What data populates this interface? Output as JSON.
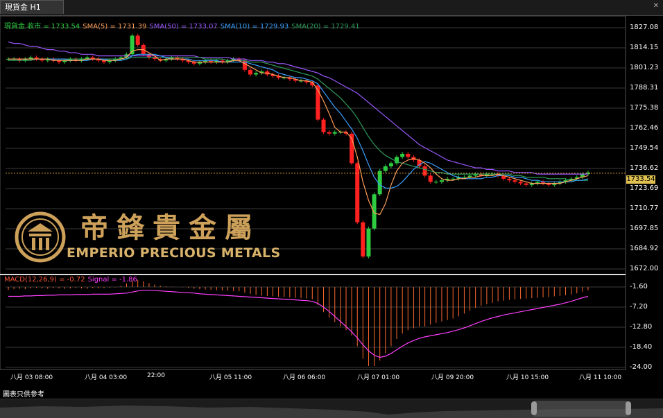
{
  "tab": {
    "title": "現貨金 H1"
  },
  "window_controls": {
    "close": "✕"
  },
  "legend_main": {
    "close": {
      "label": "現貨金.收市 = 1733.54",
      "color": "#2ecc40"
    },
    "sma5": {
      "label": "SMA(5) = 1731.39",
      "color": "#ff9f5a"
    },
    "sma50": {
      "label": "SMA(50) = 1733.07",
      "color": "#9b59ff"
    },
    "sma10": {
      "label": "SMA(10) = 1729.93",
      "color": "#3aa0ff"
    },
    "sma20": {
      "label": "SMA(20) = 1729.41",
      "color": "#2e9c5a"
    }
  },
  "legend_macd": {
    "macd": {
      "label": "MACD(12,26,9) = -0.72",
      "color": "#ff5a3a"
    },
    "signal": {
      "label": "Signal = -1.86",
      "color": "#ff40ff"
    }
  },
  "logo": {
    "chinese": "帝鋒貴金屬",
    "english": "EMPERIO PRECIOUS METALS"
  },
  "current_price": "1733.54",
  "disclaimer": "圖表只供參考",
  "chart_data": {
    "type": "candlestick",
    "price_axis": {
      "ticks": [
        "1827.08",
        "1814.15",
        "1801.23",
        "1788.31",
        "1775.38",
        "1762.46",
        "1749.54",
        "1736.62",
        "1723.69",
        "1710.77",
        "1697.85",
        "1684.92",
        "1672.00"
      ],
      "range": [
        1672.0,
        1827.08
      ]
    },
    "macd_axis": {
      "ticks": [
        "-1.60",
        "-7.20",
        "-12.80",
        "-18.40",
        "-24.00"
      ],
      "range": [
        -24.0,
        -1.6
      ]
    },
    "x_ticks": [
      "八月 03 08:00",
      "八月 04 03:00",
      "22:00",
      "八月 05 11:00",
      "八月 06 06:00",
      "八月 07 01:00",
      "八月 09 20:00",
      "八月 10 15:00",
      "八月 11 10:00"
    ],
    "close_series": [
      1807,
      1807,
      1806,
      1807,
      1808,
      1807,
      1806,
      1807,
      1806,
      1805,
      1806,
      1807,
      1806,
      1807,
      1808,
      1807,
      1806,
      1805,
      1806,
      1807,
      1808,
      1810,
      1822,
      1816,
      1810,
      1808,
      1807,
      1806,
      1807,
      1808,
      1807,
      1806,
      1805,
      1804,
      1805,
      1806,
      1805,
      1806,
      1805,
      1806,
      1807,
      1806,
      1800,
      1797,
      1798,
      1799,
      1797,
      1796,
      1795,
      1795,
      1794,
      1793,
      1793,
      1792,
      1790,
      1768,
      1760,
      1759,
      1760,
      1760,
      1759,
      1740,
      1702,
      1680,
      1698,
      1720,
      1735,
      1738,
      1740,
      1744,
      1746,
      1744,
      1742,
      1738,
      1732,
      1728,
      1728,
      1729,
      1730,
      1730,
      1731,
      1731,
      1732,
      1733,
      1732,
      1733,
      1733,
      1732,
      1730,
      1729,
      1728,
      1727,
      1726,
      1727,
      1728,
      1727,
      1726,
      1727,
      1728,
      1729,
      1730,
      1731,
      1733,
      1734
    ],
    "sma5": [
      1807,
      1807,
      1807,
      1807,
      1807,
      1807,
      1807,
      1807,
      1806,
      1806,
      1806,
      1806,
      1806,
      1806,
      1807,
      1807,
      1807,
      1806,
      1806,
      1806,
      1807,
      1808,
      1812,
      1813,
      1813,
      1811,
      1809,
      1806,
      1807,
      1807,
      1807,
      1807,
      1806,
      1805,
      1805,
      1805,
      1805,
      1805,
      1805,
      1805,
      1806,
      1806,
      1804,
      1802,
      1800,
      1798,
      1798,
      1797,
      1796,
      1795,
      1795,
      1794,
      1793,
      1793,
      1792,
      1787,
      1780,
      1772,
      1763,
      1760,
      1760,
      1756,
      1744,
      1728,
      1716,
      1708,
      1707,
      1714,
      1726,
      1735,
      1740,
      1742,
      1743,
      1742,
      1740,
      1737,
      1733,
      1730,
      1729,
      1729,
      1730,
      1730,
      1731,
      1731,
      1732,
      1732,
      1732,
      1733,
      1732,
      1731,
      1730,
      1729,
      1728,
      1727,
      1727,
      1727,
      1727,
      1727,
      1727,
      1728,
      1729,
      1730,
      1731,
      1732
    ],
    "sma10": [
      1807,
      1807,
      1807,
      1807,
      1807,
      1807,
      1807,
      1807,
      1807,
      1807,
      1807,
      1806,
      1806,
      1806,
      1806,
      1807,
      1807,
      1807,
      1806,
      1806,
      1806,
      1807,
      1809,
      1810,
      1810,
      1810,
      1810,
      1809,
      1808,
      1807,
      1807,
      1807,
      1807,
      1806,
      1806,
      1806,
      1806,
      1806,
      1805,
      1805,
      1805,
      1805,
      1805,
      1804,
      1803,
      1802,
      1801,
      1800,
      1798,
      1797,
      1796,
      1795,
      1795,
      1794,
      1793,
      1791,
      1786,
      1781,
      1776,
      1772,
      1767,
      1762,
      1756,
      1748,
      1739,
      1731,
      1726,
      1724,
      1724,
      1725,
      1728,
      1732,
      1736,
      1739,
      1741,
      1740,
      1738,
      1736,
      1734,
      1732,
      1731,
      1730,
      1730,
      1730,
      1730,
      1731,
      1731,
      1732,
      1732,
      1732,
      1731,
      1731,
      1730,
      1729,
      1729,
      1728,
      1728,
      1728,
      1728,
      1728,
      1728,
      1729,
      1729,
      1730
    ],
    "sma20": [
      1806,
      1806,
      1806,
      1806,
      1806,
      1807,
      1807,
      1807,
      1807,
      1807,
      1807,
      1807,
      1807,
      1807,
      1807,
      1807,
      1807,
      1807,
      1807,
      1807,
      1807,
      1807,
      1808,
      1808,
      1808,
      1808,
      1808,
      1808,
      1808,
      1808,
      1808,
      1808,
      1808,
      1808,
      1808,
      1807,
      1807,
      1807,
      1807,
      1806,
      1806,
      1806,
      1806,
      1805,
      1805,
      1805,
      1804,
      1803,
      1802,
      1801,
      1800,
      1799,
      1798,
      1797,
      1796,
      1794,
      1791,
      1788,
      1785,
      1782,
      1778,
      1774,
      1769,
      1763,
      1757,
      1752,
      1748,
      1745,
      1743,
      1741,
      1740,
      1739,
      1738,
      1737,
      1736,
      1735,
      1734,
      1734,
      1733,
      1733,
      1733,
      1733,
      1733,
      1733,
      1733,
      1733,
      1733,
      1733,
      1733,
      1733,
      1732,
      1732,
      1731,
      1731,
      1731,
      1731,
      1730,
      1730,
      1730,
      1730,
      1729,
      1729,
      1729,
      1729
    ],
    "sma50": [
      1818,
      1817,
      1817,
      1816,
      1815,
      1815,
      1814,
      1813,
      1813,
      1812,
      1812,
      1811,
      1811,
      1810,
      1810,
      1810,
      1809,
      1809,
      1809,
      1809,
      1809,
      1809,
      1809,
      1809,
      1809,
      1809,
      1809,
      1809,
      1809,
      1809,
      1809,
      1809,
      1809,
      1809,
      1808,
      1808,
      1808,
      1808,
      1808,
      1808,
      1807,
      1807,
      1807,
      1806,
      1806,
      1806,
      1805,
      1805,
      1804,
      1804,
      1803,
      1802,
      1801,
      1800,
      1799,
      1798,
      1796,
      1795,
      1793,
      1791,
      1789,
      1787,
      1785,
      1782,
      1779,
      1776,
      1773,
      1770,
      1767,
      1764,
      1761,
      1758,
      1755,
      1752,
      1750,
      1748,
      1746,
      1744,
      1742,
      1741,
      1740,
      1739,
      1738,
      1737,
      1737,
      1736,
      1736,
      1735,
      1735,
      1735,
      1734,
      1734,
      1734,
      1734,
      1733,
      1733,
      1733,
      1733,
      1733,
      1733,
      1733,
      1733,
      1733,
      1733
    ],
    "macd_hist": [
      -0.8,
      -0.6,
      -0.5,
      -0.6,
      -0.4,
      -0.3,
      -0.4,
      -0.5,
      -0.3,
      -0.4,
      -0.5,
      -0.4,
      -0.3,
      -0.4,
      -0.5,
      -0.3,
      -0.4,
      -0.3,
      -0.2,
      -0.1,
      0.3,
      1.0,
      1.8,
      2.0,
      1.6,
      1.1,
      0.7,
      0.4,
      0.2,
      0.1,
      0.0,
      -0.1,
      -0.3,
      -0.5,
      -0.6,
      -0.7,
      -0.8,
      -0.9,
      -1.0,
      -1.0,
      -1.1,
      -1.2,
      -1.6,
      -1.9,
      -2.2,
      -2.4,
      -2.5,
      -2.6,
      -2.7,
      -2.8,
      -2.9,
      -3.0,
      -3.1,
      -3.2,
      -3.4,
      -5.0,
      -7.0,
      -8.5,
      -9.8,
      -11.0,
      -12.0,
      -13.5,
      -16.5,
      -20.0,
      -22.0,
      -22.0,
      -20.5,
      -18.5,
      -16.5,
      -14.5,
      -13.0,
      -12.0,
      -11.5,
      -11.0,
      -11.0,
      -10.5,
      -10.0,
      -9.6,
      -9.2,
      -8.8,
      -8.2,
      -7.4,
      -6.6,
      -5.8,
      -5.2,
      -4.8,
      -4.4,
      -4.0,
      -3.8,
      -3.6,
      -3.4,
      -3.3,
      -3.2,
      -3.1,
      -3.0,
      -2.9,
      -2.8,
      -2.6,
      -2.5,
      -2.3,
      -2.1,
      -1.8,
      -1.3,
      -0.9
    ],
    "signal_line": [
      -2.6,
      -2.6,
      -2.6,
      -2.5,
      -2.5,
      -2.4,
      -2.4,
      -2.3,
      -2.3,
      -2.2,
      -2.2,
      -2.2,
      -2.1,
      -2.1,
      -2.1,
      -2.0,
      -2.0,
      -2.0,
      -2.0,
      -1.9,
      -1.8,
      -1.7,
      -1.4,
      -1.1,
      -0.9,
      -0.9,
      -1.0,
      -1.1,
      -1.2,
      -1.3,
      -1.4,
      -1.5,
      -1.6,
      -1.7,
      -1.9,
      -2.0,
      -2.1,
      -2.2,
      -2.3,
      -2.4,
      -2.5,
      -2.6,
      -2.7,
      -2.8,
      -2.9,
      -3.0,
      -3.1,
      -3.2,
      -3.3,
      -3.4,
      -3.5,
      -3.6,
      -3.7,
      -3.8,
      -4.0,
      -4.6,
      -5.6,
      -6.8,
      -8.2,
      -9.6,
      -11.0,
      -12.5,
      -14.2,
      -16.1,
      -17.8,
      -19.0,
      -19.6,
      -19.3,
      -18.5,
      -17.5,
      -16.5,
      -15.6,
      -14.9,
      -14.3,
      -13.9,
      -13.6,
      -13.3,
      -13.0,
      -12.7,
      -12.3,
      -11.9,
      -11.4,
      -10.8,
      -10.2,
      -9.6,
      -9.1,
      -8.6,
      -8.2,
      -7.8,
      -7.5,
      -7.2,
      -6.9,
      -6.6,
      -6.3,
      -6.0,
      -5.7,
      -5.4,
      -5.1,
      -4.8,
      -4.4,
      -4.0,
      -3.5,
      -3.0,
      -2.6
    ]
  }
}
